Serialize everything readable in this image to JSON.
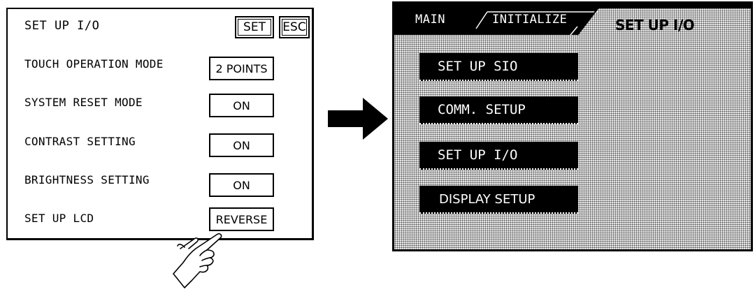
{
  "left_panel": {
    "title": "SET UP I/O",
    "set_label": "SET",
    "esc_label": "ESC",
    "rows": [
      {
        "label": "TOUCH OPERATION MODE",
        "value": "2 POINTS"
      },
      {
        "label": "SYSTEM RESET MODE",
        "value": "ON"
      },
      {
        "label": "CONTRAST SETTING",
        "value": "ON"
      },
      {
        "label": "BRIGHTNESS SETTING",
        "value": "ON"
      },
      {
        "label": "SET UP LCD",
        "value": "REVERSE"
      }
    ]
  },
  "right_panel": {
    "tabs": [
      {
        "label": "MAIN"
      },
      {
        "label": "INITIALIZE"
      },
      {
        "label": "SET UP I/O",
        "active": true
      }
    ],
    "menu": [
      {
        "label": "SET UP SIO"
      },
      {
        "label": "COMM. SETUP"
      },
      {
        "label": "SET UP I/O"
      },
      {
        "label": "DISPLAY SETUP"
      }
    ]
  },
  "icons": {
    "arrow": "right-arrow-icon",
    "hand": "pointing-hand-icon"
  },
  "colors": {
    "foreground": "#000000",
    "background": "#ffffff",
    "dither": "#555555"
  }
}
